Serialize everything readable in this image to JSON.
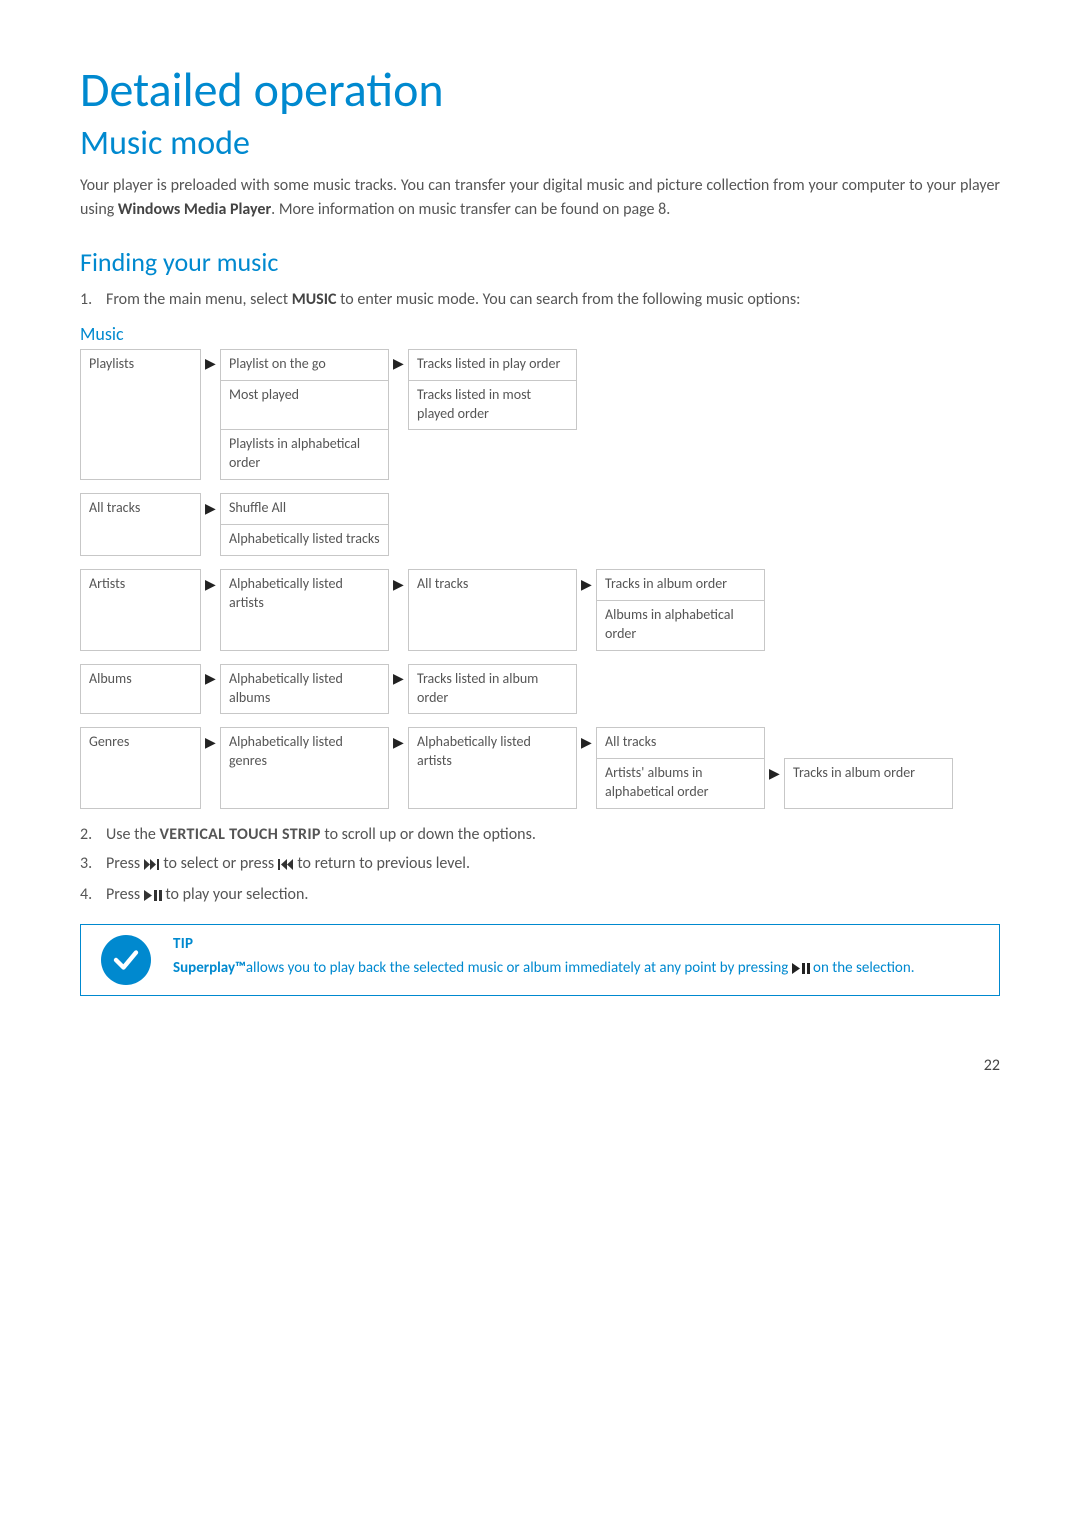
{
  "page_number": "22",
  "h1": "Detailed operation",
  "h2": "Music mode",
  "intro": {
    "pre": "Your player is preloaded with some music tracks. You can transfer your digital music and picture collection from your computer to your player using ",
    "bold": "Windows Media Player",
    "post": ". More information on music transfer can be found on page 8."
  },
  "h3": "Finding your music",
  "step1": {
    "num": "1.",
    "pre": "From the main menu, select ",
    "bold": "MUSIC",
    "post": " to enter music mode. You can search from the following music options:"
  },
  "h4": "Music",
  "chart_data": {
    "type": "table",
    "title": "Music navigation hierarchy",
    "rows": [
      {
        "l1": "Playlists",
        "l2": "Playlist on the go",
        "l3": "Tracks listed in play order"
      },
      {
        "l1": "",
        "l2": "Most played",
        "l3": "Tracks listed in most played order"
      },
      {
        "l1": "",
        "l2": "Playlists in alphabetical order",
        "l3": ""
      },
      {
        "l1": "All tracks",
        "l2": "Shuffle All",
        "l3": ""
      },
      {
        "l1": "",
        "l2": "Alphabetically listed tracks",
        "l3": ""
      },
      {
        "l1": "Artists",
        "l2": "Alphabetically listed artists",
        "l3": "All tracks",
        "l4": "Tracks in album order"
      },
      {
        "l1": "",
        "l2": "",
        "l3": "",
        "l4": "Albums in alphabetical order"
      },
      {
        "l1": "Albums",
        "l2": "Alphabetically listed albums",
        "l3": "Tracks listed in album order"
      },
      {
        "l1": "Genres",
        "l2": "Alphabetically listed genres",
        "l3": "Alphabetically listed artists",
        "l4": "All tracks"
      },
      {
        "l1": "",
        "l2": "",
        "l3": "",
        "l4": "Artists' albums in alphabetical order",
        "l5": "Tracks in album order"
      }
    ]
  },
  "arrow": "▶",
  "step2": {
    "num": "2.",
    "pre": "Use the ",
    "smallcaps": "VERTICAL TOUCH STRIP",
    "post": " to scroll up or down the options."
  },
  "step3": {
    "num": "3.",
    "pre": "Press ",
    "mid": " to select or press ",
    "post": " to return to previous level."
  },
  "step4": {
    "num": "4.",
    "pre": "Press ",
    "post": " to play your selection."
  },
  "tip": {
    "label": "TIP",
    "strong": "Superplay™",
    "line1": "allows you to play back the selected music or album immediately at any point by pressing ",
    "line2": " on the selection."
  }
}
